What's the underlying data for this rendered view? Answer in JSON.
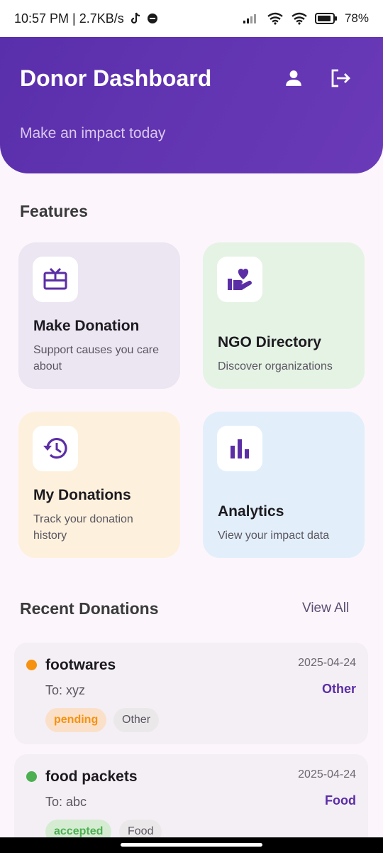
{
  "status_bar": {
    "time_speed": "10:57 PM | 2.7KB/s",
    "battery": "78%"
  },
  "header": {
    "title": "Donor Dashboard",
    "subtitle": "Make an impact today",
    "profile_icon": "person-icon",
    "logout_icon": "logout-icon"
  },
  "features": {
    "title": "Features",
    "cards": [
      {
        "title": "Make Donation",
        "desc": "Support causes you care about",
        "icon": "gift-card-icon"
      },
      {
        "title": "NGO Directory",
        "desc": "Discover organizations",
        "icon": "volunteer-hand-heart-icon"
      },
      {
        "title": "My Donations",
        "desc": "Track your donation history",
        "icon": "history-icon"
      },
      {
        "title": "Analytics",
        "desc": "View your impact data",
        "icon": "bar-chart-icon"
      }
    ]
  },
  "recent": {
    "title": "Recent Donations",
    "view_all": "View All",
    "items": [
      {
        "title": "footwares",
        "to": "To: xyz",
        "date": "2025-04-24",
        "category": "Other",
        "status": "pending",
        "type": "Other",
        "status_color": "#f5920f"
      },
      {
        "title": "food packets",
        "to": "To: abc",
        "date": "2025-04-24",
        "category": "Food",
        "status": "accepted",
        "type": "Food",
        "status_color": "#4caf50"
      }
    ]
  },
  "colors": {
    "accent": "#5b2ea6",
    "header_gradient_start": "#5a2fab",
    "header_gradient_end": "#6a3ab8"
  }
}
